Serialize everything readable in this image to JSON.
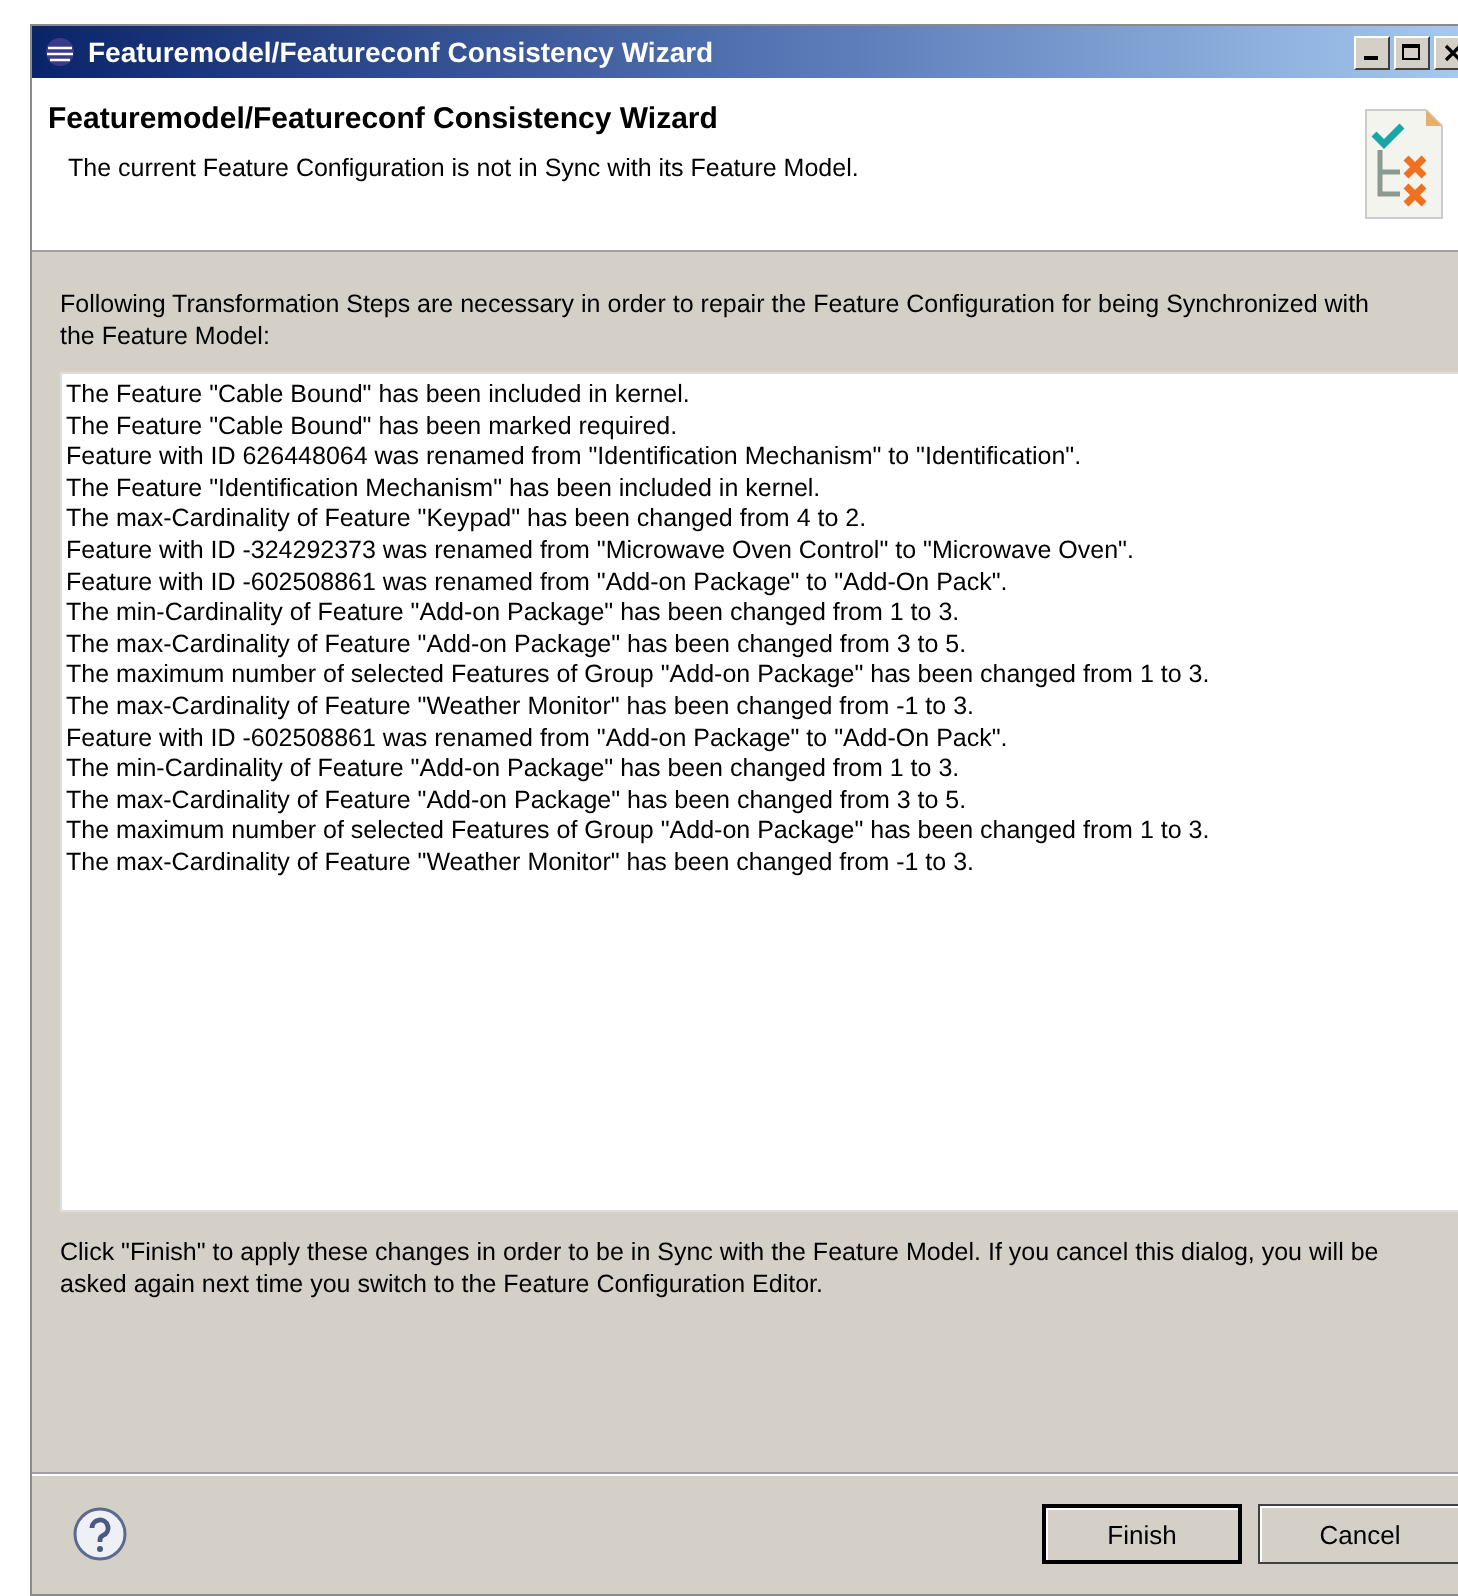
{
  "window": {
    "title": "Featuremodel/Featureconf Consistency Wizard"
  },
  "header": {
    "title": "Featuremodel/Featureconf Consistency Wizard",
    "message": "The current Feature Configuration is not in Sync with its Feature Model."
  },
  "intro": "Following Transformation Steps are necessary in order to repair the Feature Configuration for being Synchronized with the Feature Model:",
  "steps": [
    "The Feature \"Cable Bound\" has been included in kernel.",
    "The Feature \"Cable Bound\" has been marked required.",
    "Feature with ID 626448064 was renamed from \"Identification Mechanism\" to \"Identification\".",
    "The Feature \"Identification Mechanism\" has been included in kernel.",
    "The max-Cardinality of Feature \"Keypad\" has been changed from 4 to 2.",
    "Feature with ID -324292373 was renamed from \"Microwave Oven Control\" to \"Microwave Oven\".",
    "Feature with ID -602508861 was renamed from \"Add-on Package\" to \"Add-On Pack\".",
    "The min-Cardinality of Feature \"Add-on Package\" has been changed from 1 to 3.",
    "The max-Cardinality of Feature \"Add-on Package\" has been changed from 3 to 5.",
    "The maximum number of selected Features of Group \"Add-on Package\" has been changed from 1 to 3.",
    "The max-Cardinality of Feature \"Weather Monitor\" has been changed from -1 to 3.",
    "Feature with ID -602508861 was renamed from \"Add-on Package\" to \"Add-On Pack\".",
    "The min-Cardinality of Feature \"Add-on Package\" has been changed from 1 to 3.",
    "The max-Cardinality of Feature \"Add-on Package\" has been changed from 3 to 5.",
    "The maximum number of selected Features of Group \"Add-on Package\" has been changed from 1 to 3.",
    "The max-Cardinality of Feature \"Weather Monitor\" has been changed from -1 to 3."
  ],
  "note": "Click \"Finish\" to apply these changes in order to be in Sync with the Feature Model. If you cancel this dialog, you will be asked again next time you switch to the Feature Configuration Editor.",
  "buttons": [
    {
      "label": "Finish",
      "default": true
    },
    {
      "label": "Cancel",
      "default": false
    }
  ]
}
